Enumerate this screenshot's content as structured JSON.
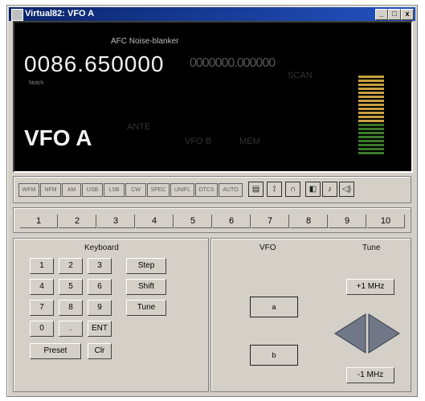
{
  "window": {
    "title": "Virtual82: VFO A",
    "icon": "app-icon"
  },
  "title_buttons": [
    "_",
    "□",
    "x"
  ],
  "display": {
    "flags": "AFC  Noise-blanker",
    "frequency": "0086.650000",
    "sub_label": "Notch",
    "secondary_frequency": "0000000.000000",
    "vfo_label": "VFO A",
    "dim_labels": [
      "ANTE",
      "VFO B",
      "MEM",
      "SCAN"
    ]
  },
  "mode_buttons": [
    "WFM",
    "NFM",
    "AM",
    "USB",
    "LSB",
    "CW",
    "SPEC",
    "UNIFL",
    "DTCS",
    "AUTO"
  ],
  "toolbar_icons": [
    "tape-icon",
    "antenna-icon",
    "headphones-icon",
    "speaker-icon",
    "note-icon",
    "speaker-loud-icon"
  ],
  "memory_channels": [
    "1",
    "2",
    "3",
    "4",
    "5",
    "6",
    "7",
    "8",
    "9",
    "10"
  ],
  "keyboard": {
    "title": "Keyboard",
    "keys": [
      "1",
      "2",
      "3",
      "4",
      "5",
      "6",
      "7",
      "8",
      "9",
      "0",
      ".",
      "ENT"
    ],
    "side_buttons": [
      "Step",
      "Shift",
      "Tune"
    ],
    "preset": "Preset",
    "clear": "Clr"
  },
  "vfo": {
    "title": "VFO",
    "a_button": "a",
    "b_button": "b"
  },
  "tune": {
    "title": "Tune",
    "up": "+1 MHz",
    "down": "-1 MHz"
  },
  "colors": {
    "display_bg": "#000000",
    "meter_low": "#3a7a2a",
    "meter_high": "#c8a040"
  }
}
